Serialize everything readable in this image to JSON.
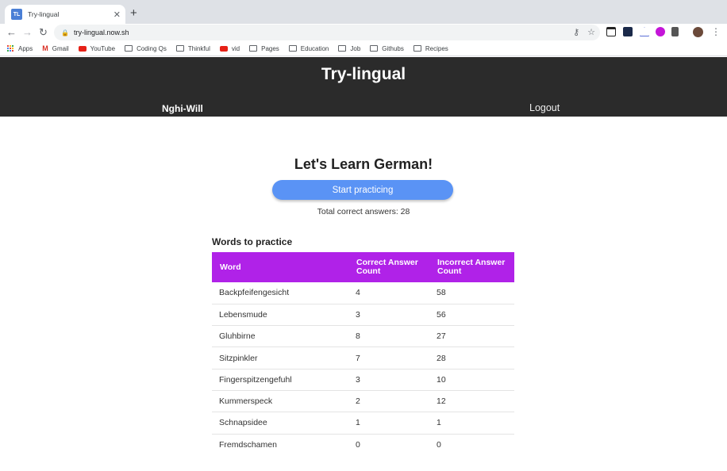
{
  "browser": {
    "tab_title": "Try-lingual",
    "tab_favicon": "TL",
    "url": "try-lingual.now.sh",
    "bookmarks": [
      {
        "label": "Apps",
        "icon": "apps-grid-icon"
      },
      {
        "label": "Gmail",
        "icon": "gmail-icon"
      },
      {
        "label": "YouTube",
        "icon": "youtube-icon"
      },
      {
        "label": "Coding Qs",
        "icon": "folder-icon"
      },
      {
        "label": "Thinkful",
        "icon": "folder-icon"
      },
      {
        "label": "vid",
        "icon": "youtube-icon"
      },
      {
        "label": "Pages",
        "icon": "folder-icon"
      },
      {
        "label": "Education",
        "icon": "folder-icon"
      },
      {
        "label": "Job",
        "icon": "folder-icon"
      },
      {
        "label": "Githubs",
        "icon": "folder-icon"
      },
      {
        "label": "Recipes",
        "icon": "folder-icon"
      }
    ]
  },
  "header": {
    "title": "Try-lingual",
    "username": "Nghi-Will",
    "logout": "Logout"
  },
  "main": {
    "heading": "Let's Learn German!",
    "start_button": "Start practicing",
    "total_correct": "Total correct answers: 28"
  },
  "words": {
    "title": "Words to practice",
    "columns": [
      "Word",
      "Correct Answer Count",
      "Incorrect Answer Count"
    ],
    "rows": [
      [
        "Backpfeifengesicht",
        "4",
        "58"
      ],
      [
        "Lebensmude",
        "3",
        "56"
      ],
      [
        "Gluhbirne",
        "8",
        "27"
      ],
      [
        "Sitzpinkler",
        "7",
        "28"
      ],
      [
        "Fingerspitzengefuhl",
        "3",
        "10"
      ],
      [
        "Kummerspeck",
        "2",
        "12"
      ],
      [
        "Schnapsidee",
        "1",
        "1"
      ],
      [
        "Fremdschamen",
        "0",
        "0"
      ]
    ]
  },
  "colors": {
    "header_bg": "#2b2b2b",
    "button": "#5a93f5",
    "table_header": "#b022e8"
  }
}
